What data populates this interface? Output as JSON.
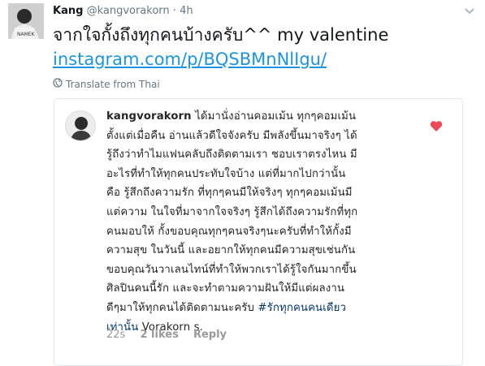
{
  "tweet": {
    "author_name": "Kang",
    "author_handle": "@kangvorakorn",
    "dot": "·",
    "time": "4h",
    "text": "จากใจกั้งถึงทุกคนบ้างครับ^^ my valentine",
    "link": "instagram.com/p/BQSBMnNlIgu/",
    "translate_label": "Translate from Thai"
  },
  "instagram_comment": {
    "username": "kangvorakorn",
    "lines": [
      "ได้มานั่งอ่านคอมเม้น ทุกๆคอมเม้น",
      "ตั้งแต่เมื่อคืน อ่านแล้วดีใจจังครับ มีพลังขึ้นมาจริงๆ ได้",
      "รู้ถึงว่าทำไมแฟนคลับถึงติดตามเรา ชอบเราตรงไหน มี",
      "อะไรที่ทำให้ทุกคนประทับใจบ้าง แต่ที่มากไปกว่านั้น",
      "คือ รู้สึกถึงความรัก ที่ทุกๆคนมีให้จริงๆ ทุกๆคอมเม้นมี",
      "แต่ความ ในใจที่มาจากใจจริงๆ รู้สึกได้ถึงความรักที่ทุก",
      "คนมอบให้ กั้งขอบคุณทุกๆคนจริงๆนะครับที่ทำให้กั้งมี",
      "ความสุข ในวันนี้ และอยากให้ทุกคนมีความสุขเช่นกัน",
      "ขอบคุณวันวาเลนไทน์ที่ทำให้พวกเราได้รู้ใจกันมากขึ้น",
      "ศิลปินคนนี้รัก และจะทำตามความฝันให้มีแต่ผลงาน",
      "ดีๆมาให้ทุกคนได้ติดตามนะครับ"
    ],
    "hashtag_line_start": "#รักทุกคนคนเดียว",
    "hashtag_line_end": "เท่านั้น",
    "signature": "Vorakorn s.",
    "age": "22s",
    "likes": "2 likes",
    "reply": "Reply"
  },
  "colors": {
    "link": "#1b95e0",
    "heart": "#ed4956",
    "hashtag": "#003569",
    "meta": "#999999"
  },
  "icons": [
    "chevron-down-icon",
    "globe-icon",
    "heart-icon"
  ]
}
